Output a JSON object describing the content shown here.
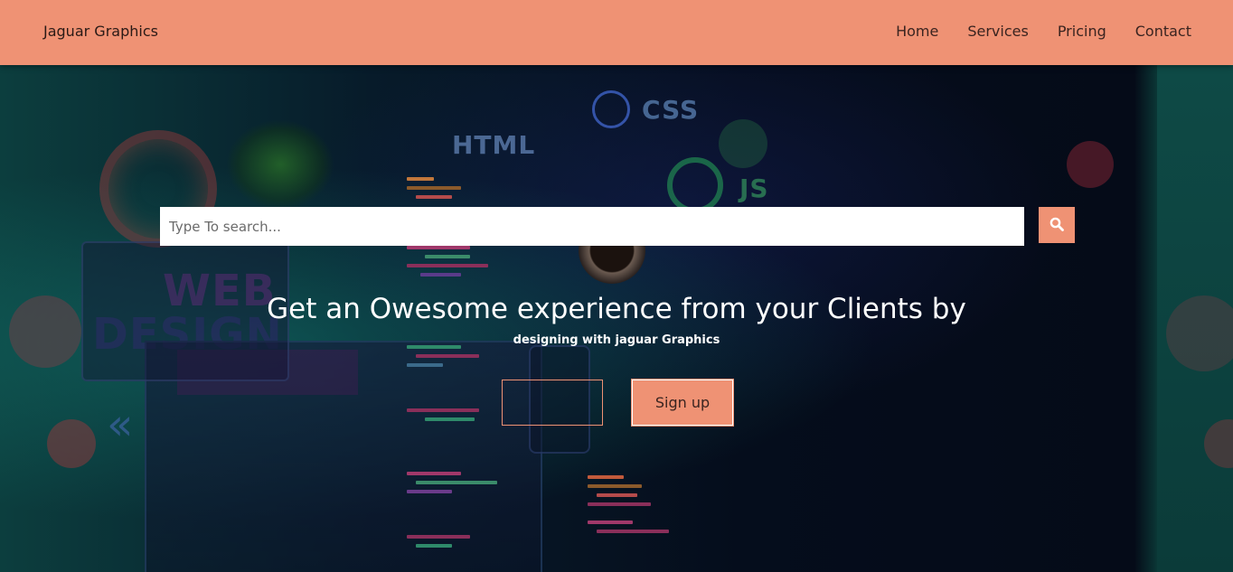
{
  "navbar": {
    "brand": "Jaguar Graphics",
    "links": [
      "Home",
      "Services",
      "Pricing",
      "Contact"
    ]
  },
  "search": {
    "placeholder": "Type To search...",
    "button_icon": "search-icon"
  },
  "hero": {
    "headline": "Get an Owesome experience from your Clients by",
    "subheadline": "designing with jaguar Graphics",
    "signup_label": "Sign up",
    "background_words": [
      "HTML",
      "CSS",
      "JS",
      "WEB",
      "DESIGN"
    ]
  },
  "colors": {
    "accent": "#ef9274",
    "hero_dark": "#050d1c",
    "teal": "#0d4743"
  }
}
